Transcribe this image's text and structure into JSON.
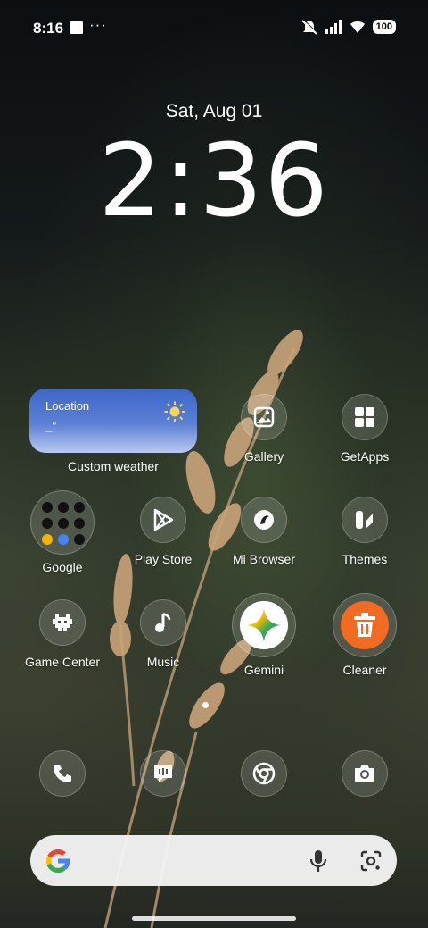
{
  "status_bar": {
    "time": "8:16",
    "more_glyph": "···",
    "battery": "100"
  },
  "lockclock": {
    "date": "Sat, Aug 01",
    "time": "2:36"
  },
  "weather_widget": {
    "location": "Location",
    "temperature": "_°",
    "label": "Custom weather",
    "icon": "sun-icon"
  },
  "apps": {
    "gallery": "Gallery",
    "getapps": "GetApps",
    "google": "Google",
    "play_store": "Play Store",
    "mi_browser": "Mi Browser",
    "themes": "Themes",
    "game_center": "Game Center",
    "music": "Music",
    "gemini": "Gemini",
    "cleaner": "Cleaner"
  },
  "dock": [
    "phone-icon",
    "messages-icon",
    "chrome-icon",
    "camera-icon"
  ],
  "search_bar": {
    "icons": [
      "google-g-icon",
      "mic-icon",
      "lens-icon"
    ]
  },
  "colors": {
    "cleaner_orange": "#f26b22",
    "weather_blue": "#3c66c9",
    "sun_yellow": "#ffd54a"
  }
}
